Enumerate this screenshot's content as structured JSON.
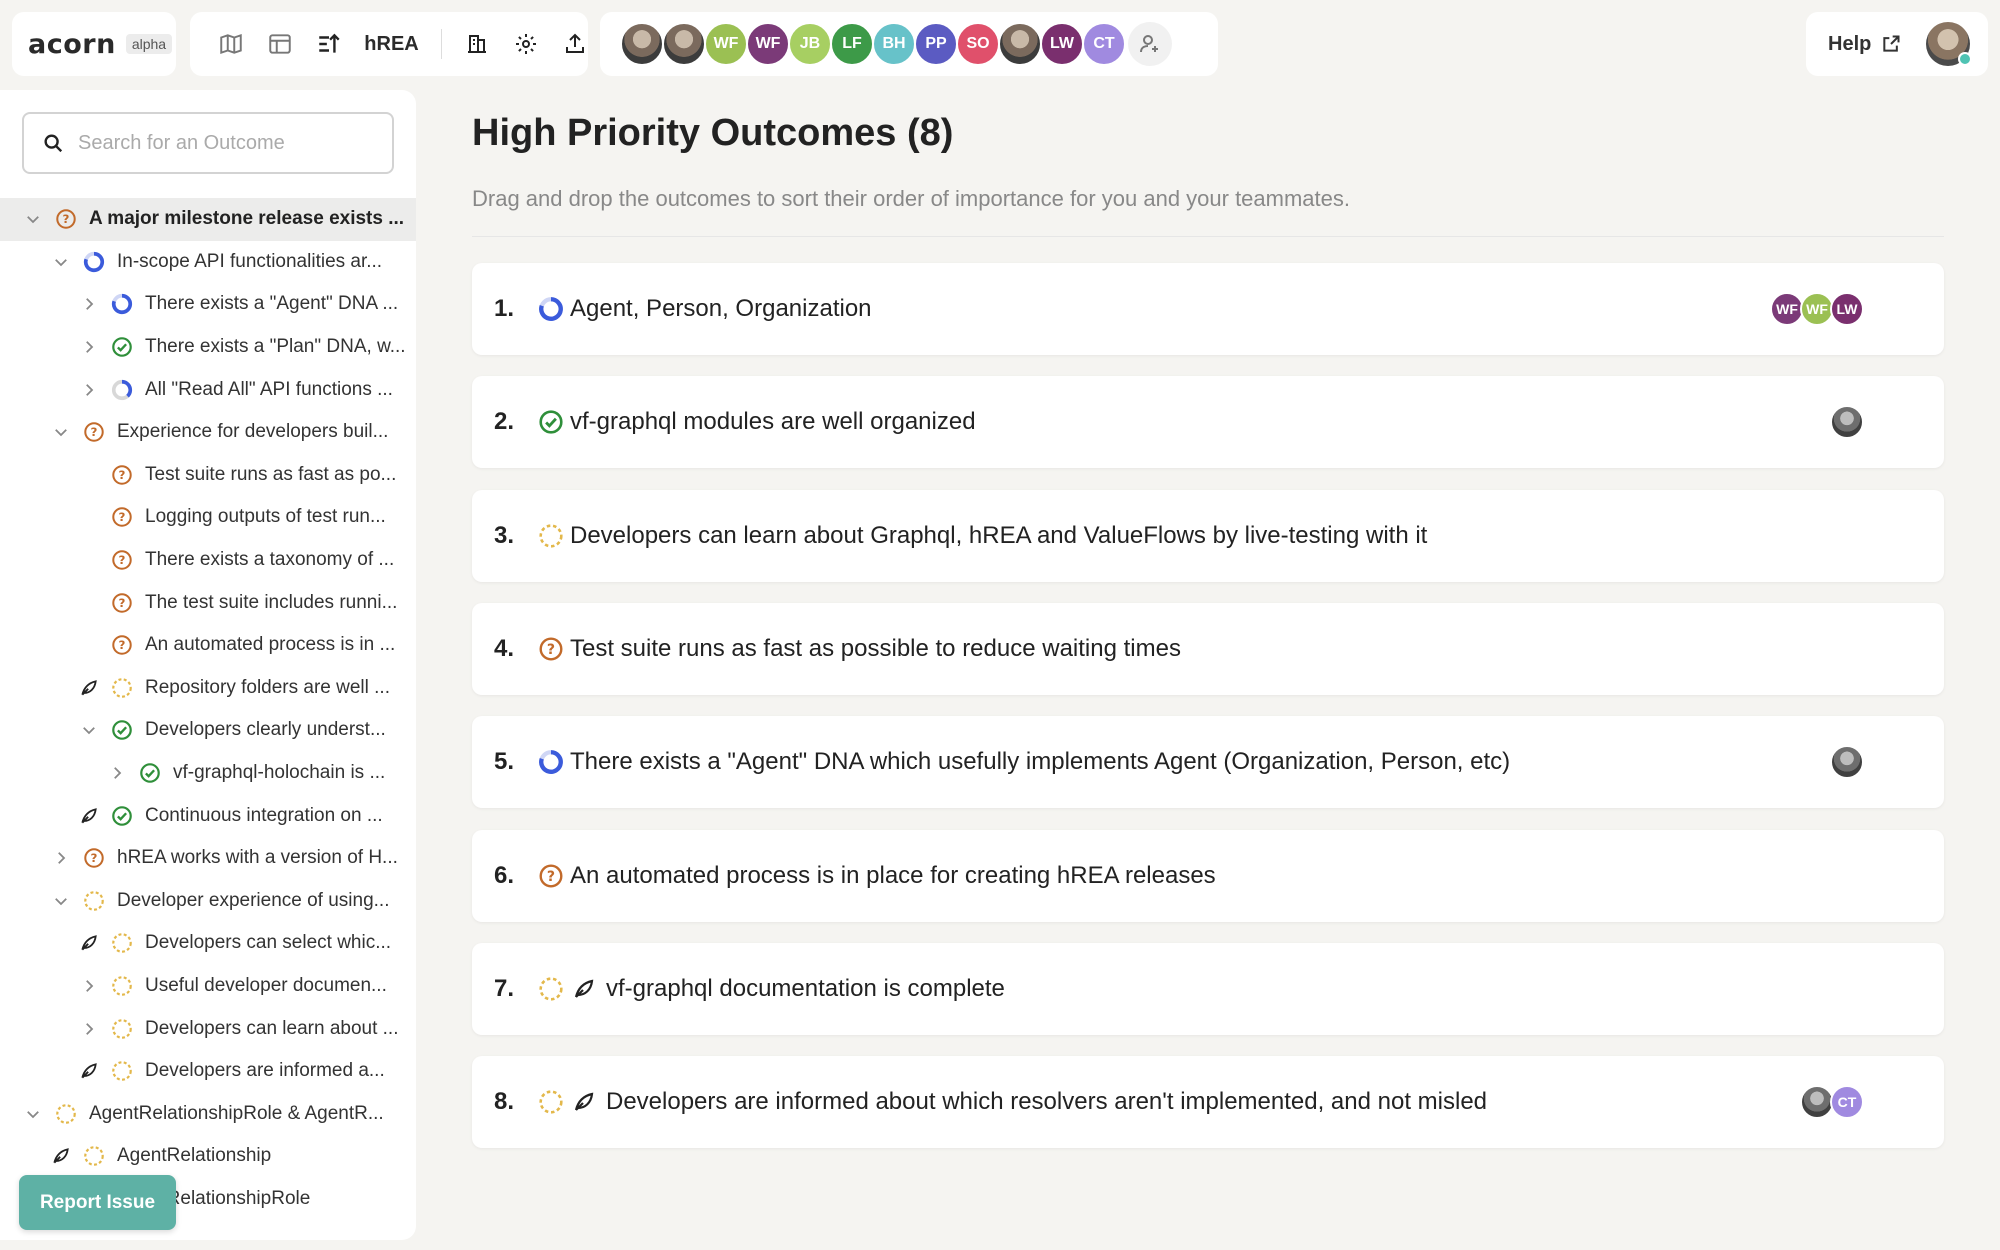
{
  "app": {
    "logo": "acorn",
    "badge": "alpha",
    "project_name": "hREA",
    "help_label": "Help"
  },
  "colors": {
    "accent": "#5eb1a5",
    "status_uncertain": "#c26a2a",
    "status_achieved": "#2f8f3a",
    "status_partial": "#3b5bdb",
    "status_notachieved": "#e3b84b"
  },
  "members": [
    {
      "type": "photo"
    },
    {
      "type": "photo"
    },
    {
      "initials": "WF",
      "color": "#9bc053"
    },
    {
      "initials": "WF",
      "color": "#7b3a78"
    },
    {
      "initials": "JB",
      "color": "#a7cf62"
    },
    {
      "initials": "LF",
      "color": "#3d9a48"
    },
    {
      "initials": "BH",
      "color": "#67c2c9"
    },
    {
      "initials": "PP",
      "color": "#5b5bc2"
    },
    {
      "initials": "SO",
      "color": "#e0506b"
    },
    {
      "type": "photo"
    },
    {
      "initials": "LW",
      "color": "#7a2f6e"
    },
    {
      "initials": "CT",
      "color": "#a08ae0"
    }
  ],
  "sidebar": {
    "search_placeholder": "Search for an Outcome",
    "report_label": "Report Issue",
    "items": [
      {
        "label": "A major milestone release exists ...",
        "level": 0,
        "chevron": "down",
        "status": "uncertain",
        "selected": true
      },
      {
        "label": "In-scope API functionalities ar...",
        "level": 1,
        "chevron": "down",
        "status": "partial"
      },
      {
        "label": "There exists a \"Agent\" DNA ...",
        "level": 2,
        "chevron": "right",
        "status": "partial"
      },
      {
        "label": "There exists a \"Plan\" DNA, w...",
        "level": 2,
        "chevron": "right",
        "status": "achieved"
      },
      {
        "label": "All \"Read All\" API functions ...",
        "level": 2,
        "chevron": "right",
        "status": "partial-small"
      },
      {
        "label": "Experience for developers buil...",
        "level": 1,
        "chevron": "down",
        "status": "uncertain"
      },
      {
        "label": "Test suite runs as fast as po...",
        "level": 2,
        "chevron": "none",
        "status": "uncertain"
      },
      {
        "label": "Logging outputs of test run...",
        "level": 2,
        "chevron": "none",
        "status": "uncertain"
      },
      {
        "label": "There exists a taxonomy of ...",
        "level": 2,
        "chevron": "none",
        "status": "uncertain"
      },
      {
        "label": "The test suite includes runni...",
        "level": 2,
        "chevron": "none",
        "status": "uncertain"
      },
      {
        "label": "An automated process is in ...",
        "level": 2,
        "chevron": "none",
        "status": "uncertain"
      },
      {
        "label": "Repository folders are well ...",
        "level": 2,
        "chevron": "leaf",
        "status": "notachieved"
      },
      {
        "label": "Developers clearly underst...",
        "level": 2,
        "chevron": "down",
        "status": "achieved"
      },
      {
        "label": "vf-graphql-holochain is ...",
        "level": 3,
        "chevron": "right",
        "status": "achieved"
      },
      {
        "label": "Continuous integration on ...",
        "level": 2,
        "chevron": "leaf",
        "status": "achieved"
      },
      {
        "label": "hREA works with a version of H...",
        "level": 1,
        "chevron": "right",
        "status": "uncertain"
      },
      {
        "label": "Developer experience of using...",
        "level": 1,
        "chevron": "down",
        "status": "notachieved"
      },
      {
        "label": "Developers can select whic...",
        "level": 2,
        "chevron": "leaf",
        "status": "notachieved"
      },
      {
        "label": "Useful developer documen...",
        "level": 2,
        "chevron": "right",
        "status": "notachieved"
      },
      {
        "label": "Developers can learn about ...",
        "level": 2,
        "chevron": "right",
        "status": "notachieved"
      },
      {
        "label": "Developers are informed a...",
        "level": 2,
        "chevron": "leaf",
        "status": "notachieved"
      },
      {
        "label": "AgentRelationshipRole & AgentR...",
        "level": 0,
        "chevron": "down",
        "status": "notachieved"
      },
      {
        "label": "AgentRelationship",
        "level": 1,
        "chevron": "leaf",
        "status": "notachieved"
      },
      {
        "label": "AgentRelationshipRole",
        "level": 1,
        "chevron": "leaf",
        "status": "notachieved"
      }
    ]
  },
  "main": {
    "title": "High Priority Outcomes (8)",
    "subtitle": "Drag and drop the outcomes to sort their order of importance for you and your teammates.",
    "outcomes": [
      {
        "number": "1.",
        "text": "Agent, Person, Organization",
        "status": "partial",
        "leaf": false,
        "assignees": [
          {
            "initials": "WF",
            "color": "#7b3a78"
          },
          {
            "initials": "WF",
            "color": "#9bc053"
          },
          {
            "initials": "LW",
            "color": "#7a2f6e"
          }
        ]
      },
      {
        "number": "2.",
        "text": "vf-graphql modules are well organized",
        "status": "achieved",
        "leaf": false,
        "assignees": [
          {
            "type": "photo"
          }
        ]
      },
      {
        "number": "3.",
        "text": "Developers can learn about Graphql, hREA and ValueFlows by live-testing with it",
        "status": "notachieved",
        "leaf": false,
        "assignees": []
      },
      {
        "number": "4.",
        "text": "Test suite runs as fast as possible to reduce waiting times",
        "status": "uncertain",
        "leaf": false,
        "assignees": []
      },
      {
        "number": "5.",
        "text": "There exists a \"Agent\" DNA which usefully implements Agent (Organization, Person, etc)",
        "status": "partial",
        "leaf": false,
        "assignees": [
          {
            "type": "photo"
          }
        ]
      },
      {
        "number": "6.",
        "text": "An automated process is in place for creating hREA releases",
        "status": "uncertain",
        "leaf": false,
        "assignees": []
      },
      {
        "number": "7.",
        "text": "vf-graphql documentation is complete",
        "status": "notachieved",
        "leaf": true,
        "assignees": []
      },
      {
        "number": "8.",
        "text": "Developers are informed about which resolvers aren't implemented, and not misled",
        "status": "notachieved",
        "leaf": true,
        "assignees": [
          {
            "type": "photo"
          },
          {
            "initials": "CT",
            "color": "#a08ae0"
          }
        ]
      }
    ]
  }
}
